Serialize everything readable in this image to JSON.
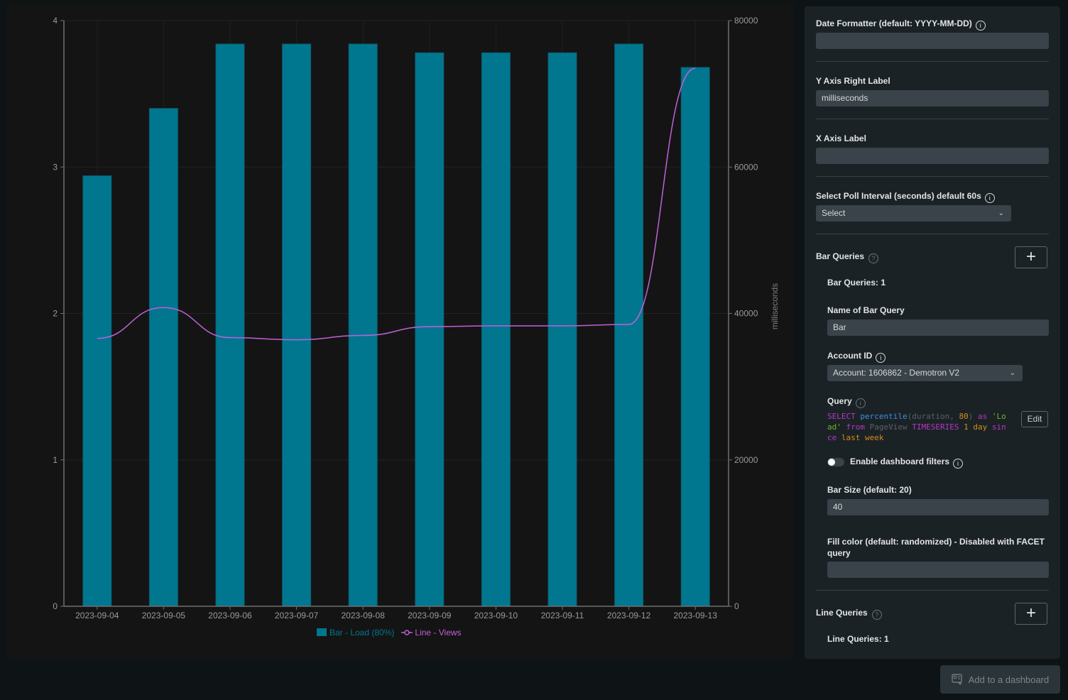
{
  "chart_data": {
    "type": "bar",
    "title": "",
    "categories": [
      "2023-09-04",
      "2023-09-05",
      "2023-09-06",
      "2023-09-07",
      "2023-09-08",
      "2023-09-09",
      "2023-09-10",
      "2023-09-11",
      "2023-09-12",
      "2023-09-13"
    ],
    "series": [
      {
        "name": "Bar - Load (80%)",
        "type": "bar",
        "axis": "left",
        "color": "#00778f",
        "values": [
          2.94,
          3.4,
          3.84,
          3.84,
          3.84,
          3.78,
          3.78,
          3.78,
          3.84,
          3.68
        ]
      },
      {
        "name": "Line - Views",
        "type": "line",
        "axis": "right",
        "color": "#c060d8",
        "values": [
          36600,
          40800,
          36700,
          36400,
          37000,
          38200,
          38300,
          38300,
          38500,
          73500
        ]
      }
    ],
    "xlabel": "",
    "ylabel_left": "",
    "ylabel_right": "milliseconds",
    "ylim_left": [
      0,
      4
    ],
    "yticks_left": [
      "0",
      "1",
      "2",
      "3",
      "4"
    ],
    "ylim_right": [
      0,
      80000
    ],
    "yticks_right": [
      "0",
      "20000",
      "40000",
      "60000",
      "80000"
    ],
    "grid": true,
    "legend_position": "bottom-center"
  },
  "legend": {
    "bar": "Bar - Load (80%)",
    "line": "Line - Views"
  },
  "settings": {
    "date_formatter_label": "Date Formatter (default: YYYY-MM-DD)",
    "date_formatter_value": "",
    "y_axis_right_label": "Y Axis Right Label",
    "y_axis_right_value": "milliseconds",
    "x_axis_label": "X Axis Label",
    "x_axis_value": "",
    "poll_interval_label": "Select Poll Interval (seconds) default 60s",
    "poll_interval_value": "Select",
    "bar_queries_label": "Bar Queries",
    "bar_queries_count": "Bar Queries: 1",
    "bar_query_name_label": "Name of Bar Query",
    "bar_query_name_value": "Bar",
    "account_id_label": "Account ID",
    "account_id_value": "Account: 1606862 - Demotron V2",
    "query_label": "Query",
    "query_tokens": {
      "t1": "SELECT",
      "t2": "percentile",
      "t3": "(duration, ",
      "t4": "80",
      "t5": ") ",
      "t6": "as",
      "t7": "'Load'",
      "t8": "from",
      "t9": "PageView",
      "t10": "TIMESERIES",
      "t11": "1 day",
      "t12": "since",
      "t13": "last week"
    },
    "edit_label": "Edit",
    "dashboard_filters_label": "Enable dashboard filters",
    "dashboard_filters_enabled": false,
    "bar_size_label": "Bar Size (default: 20)",
    "bar_size_value": "40",
    "fill_color_label": "Fill color (default: randomized) - Disabled with FACET query",
    "fill_color_value": "",
    "line_queries_label": "Line Queries",
    "line_queries_count": "Line Queries: 1",
    "info_glyph": "i",
    "help_glyph": "?",
    "plus_glyph": "+",
    "chevron_glyph": "⌄"
  },
  "footer": {
    "add_to_dashboard": "Add to a dashboard"
  }
}
